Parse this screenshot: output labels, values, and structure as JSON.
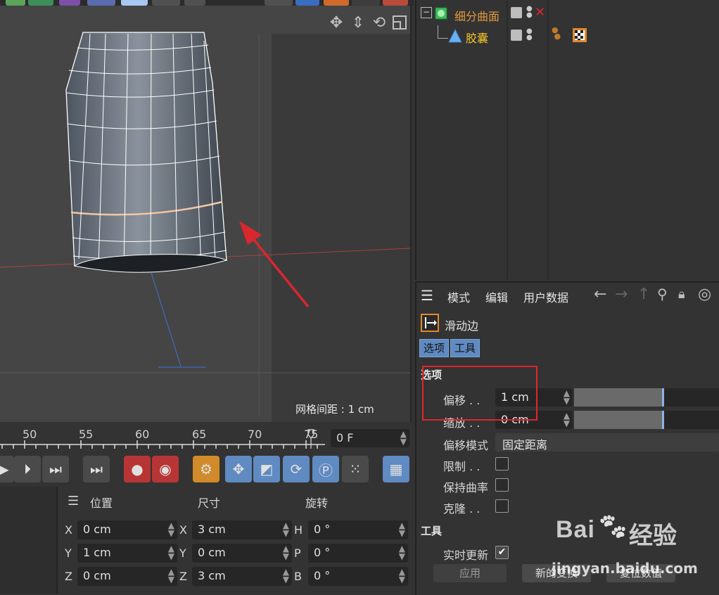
{
  "viewport": {
    "grid_spacing_label": "网格间距 : 1 cm"
  },
  "timeline": {
    "ticks": [
      "50",
      "55",
      "60",
      "65",
      "70",
      "75"
    ],
    "current_frame": "0 F"
  },
  "coordinates": {
    "headers": {
      "position": "位置",
      "size": "尺寸",
      "rotation": "旋转"
    },
    "rows": [
      {
        "pos_axis": "X",
        "pos_value": "0 cm",
        "size_axis": "X",
        "size_value": "3 cm",
        "rot_axis": "H",
        "rot_value": "0 °"
      },
      {
        "pos_axis": "Y",
        "pos_value": "1 cm",
        "size_axis": "Y",
        "size_value": "0 cm",
        "rot_axis": "P",
        "rot_value": "0 °"
      },
      {
        "pos_axis": "Z",
        "pos_value": "0 cm",
        "size_axis": "Z",
        "size_value": "3 cm",
        "rot_axis": "B",
        "rot_value": "0 °"
      }
    ]
  },
  "object_manager": {
    "items": [
      {
        "name": "细分曲面",
        "color": "#e39a3c"
      },
      {
        "name": "胶囊",
        "color": "#f2c428"
      }
    ]
  },
  "attributes": {
    "menu": {
      "mode": "模式",
      "edit": "编辑",
      "user_data": "用户数据"
    },
    "tool_name": "滑动边",
    "tabs": [
      "选项",
      "工具"
    ],
    "options_section": "选项",
    "offset_label": "偏移 . .",
    "offset_value": "1 cm",
    "offset_fill": 0.6,
    "scale_label": "缩放 . .",
    "scale_value": "0 cm",
    "scale_fill": 0.6,
    "offset_mode_label": "偏移模式",
    "offset_mode_value": "固定距离",
    "limit_label": "限制 . .",
    "keep_curvature_label": "保持曲率",
    "clone_label": "克隆 . .",
    "tool_section": "工具",
    "realtime_label": "实时更新",
    "apply_button": "应用",
    "new_transform_button": "新的变换",
    "reset_button": "复位数值"
  },
  "watermark": {
    "logo_text": "Bai du 经验",
    "url": "jingyan.baidu.com"
  },
  "colors": {
    "highlight_red": "#e0262d",
    "arrow_red": "#d9272e",
    "accent_blue": "#5f8ac2",
    "edge_highlight": "#f2c6a4"
  }
}
